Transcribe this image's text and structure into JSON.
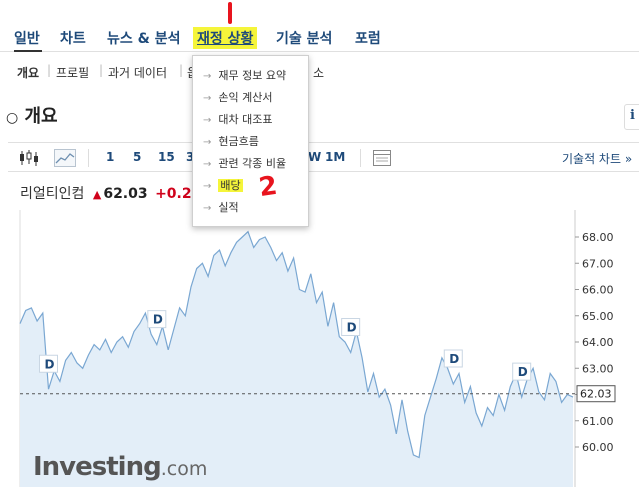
{
  "topnav": {
    "items": [
      "일반",
      "차트",
      "뉴스 & 분석",
      "재정 상황",
      "기술 분석",
      "포럼"
    ]
  },
  "subnav": {
    "items": [
      "개요",
      "프로필",
      "과거 데이터",
      "옵",
      "소"
    ]
  },
  "dropdown": {
    "items": [
      "재무 정보 요약",
      "손익 계산서",
      "대차 대조표",
      "현금흐름",
      "관련 각종 비율",
      "배당",
      "실적"
    ]
  },
  "annotation": {
    "marker2": "2"
  },
  "section": {
    "title": "개요",
    "info": "i"
  },
  "toolbar": {
    "ranges": [
      "1",
      "5",
      "15",
      "3",
      "W",
      "1M"
    ],
    "tech_chart": "기술적 차트 »"
  },
  "ticker": {
    "name": "리얼티인컴",
    "price": "62.03",
    "change": "+0.2"
  },
  "watermark": {
    "brand": "Investing",
    "tld": ".com"
  },
  "colors": {
    "nav": "#1e4a7a",
    "highlight": "#f5f53a",
    "marker": "#e8141e",
    "up": "#d0021b",
    "line": "#7aa7d2",
    "fill": "#e3eef8"
  },
  "chart_data": {
    "type": "area",
    "yticks": [
      "68.00",
      "67.00",
      "66.00",
      "65.00",
      "64.00",
      "63.00",
      "62.00",
      "61.00",
      "60.00"
    ],
    "ylim": [
      59.3,
      68.3
    ],
    "current_label": "62.03",
    "current_value": 62.03,
    "dividend_markers": [
      "D",
      "D",
      "D",
      "D",
      "D",
      "D"
    ],
    "values": [
      64.7,
      65.2,
      65.3,
      64.8,
      65.1,
      62.2,
      62.9,
      62.5,
      63.3,
      63.6,
      63.2,
      63.0,
      63.5,
      63.9,
      63.7,
      64.1,
      63.6,
      64.0,
      64.2,
      63.8,
      64.4,
      64.7,
      65.1,
      64.3,
      63.9,
      64.6,
      63.7,
      64.5,
      65.3,
      65.0,
      66.1,
      66.8,
      67.0,
      66.5,
      67.3,
      67.5,
      66.9,
      67.4,
      67.8,
      68.0,
      68.2,
      67.6,
      67.9,
      68.0,
      67.6,
      67.1,
      67.4,
      66.7,
      67.2,
      66.0,
      65.9,
      66.6,
      65.5,
      65.9,
      64.6,
      65.5,
      64.2,
      64.0,
      63.6,
      64.4,
      63.4,
      62.1,
      62.8,
      61.9,
      62.2,
      61.6,
      60.5,
      61.8,
      60.6,
      59.7,
      59.6,
      61.2,
      61.9,
      62.6,
      63.4,
      63.0,
      62.4,
      62.8,
      61.7,
      62.3,
      61.3,
      60.8,
      61.5,
      61.2,
      62.0,
      61.4,
      62.3,
      62.8,
      61.9,
      62.6,
      63.0,
      62.1,
      61.8,
      62.8,
      62.5,
      61.7,
      62.0,
      61.9
    ]
  }
}
